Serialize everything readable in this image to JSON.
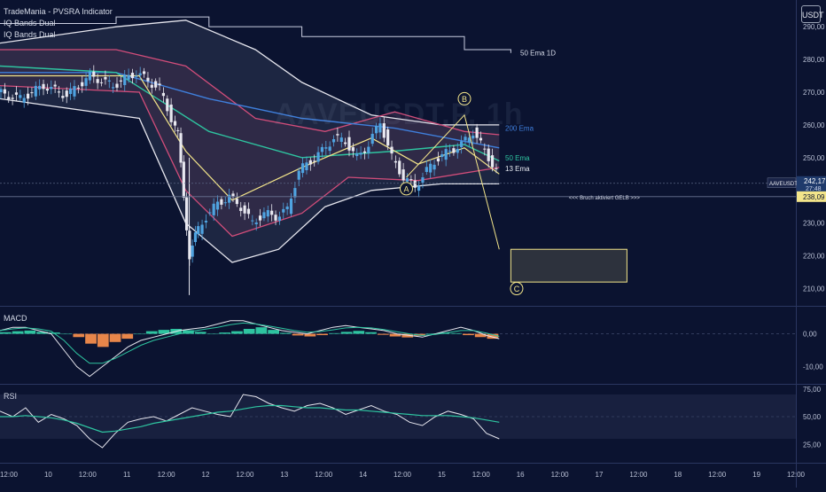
{
  "header": {
    "indicators": [
      "TradeMania - PVSRA Indicator",
      "IQ Bands Dual",
      "IQ Bands Dual"
    ],
    "currency_button": "USDT",
    "watermark": "AAVEUSDT.P, 1h"
  },
  "colors": {
    "background": "#0b1330",
    "bull": "#4fa3e0",
    "bear": "#e8e8f0",
    "ema200": "#3f7fdc",
    "ema50": "#2ec4a0",
    "ema13": "#f3e58a",
    "band_outer": "#e6e6ee",
    "band_inner": "#d24d7a",
    "macd_pos": "#2ec4a0",
    "macd_neg": "#e8864a",
    "rsi_line": "#e6e6ee",
    "rsi_ma": "#2ec4a0",
    "target_box": "#f3e58a"
  },
  "chart_data": [
    {
      "type": "candlestick",
      "symbol": "AAVEUSDT.P",
      "timeframe": "1h",
      "x_ticks": [
        "12:00",
        "10",
        "12:00",
        "11",
        "12:00",
        "12",
        "12:00",
        "13",
        "12:00",
        "14",
        "12:00",
        "15",
        "12:00",
        "16",
        "12:00",
        "17",
        "12:00",
        "18",
        "12:00",
        "19",
        "12:00"
      ],
      "y_ticks": [
        "210,00",
        "220,00",
        "230,00",
        "240,00",
        "250,00",
        "260,00",
        "270,00",
        "280,00",
        "290,00"
      ],
      "ylim": [
        205,
        296
      ],
      "last_price": "242,17",
      "countdown": "27:48",
      "level_price": "238,09",
      "series_labels": {
        "ema_1d": "50 Ema 1D",
        "ema200": "200 Ema",
        "ema50": "50 Ema",
        "ema13": "13 Ema"
      },
      "annotations": {
        "breakout": "<<< Bruch aktiviert GELB >>>",
        "wave_a": "A",
        "wave_b": "B",
        "wave_c": "C"
      },
      "ohlc_path": [
        [
          0,
          270,
          279
        ],
        [
          2,
          268,
          277
        ],
        [
          4,
          272,
          275
        ],
        [
          6,
          269,
          276
        ],
        [
          8,
          275,
          274
        ],
        [
          10,
          272,
          277
        ],
        [
          12,
          276,
          275
        ],
        [
          14,
          271,
          274
        ],
        [
          15,
          262,
          270
        ],
        [
          15.5,
          257,
          262
        ],
        [
          16,
          238,
          258
        ],
        [
          16.5,
          220,
          242
        ],
        [
          17,
          226,
          234
        ],
        [
          18,
          232,
          236
        ],
        [
          19,
          236,
          239
        ],
        [
          20,
          238,
          234
        ],
        [
          21,
          235,
          230
        ],
        [
          22,
          230,
          234
        ],
        [
          23,
          233,
          231
        ],
        [
          24,
          232,
          234
        ],
        [
          25,
          234,
          246
        ],
        [
          26,
          246,
          250
        ],
        [
          27,
          249,
          252
        ],
        [
          28,
          252,
          257
        ],
        [
          29,
          256,
          254
        ],
        [
          30,
          255,
          251
        ],
        [
          31,
          250,
          254
        ],
        [
          32,
          254,
          262
        ],
        [
          33,
          261,
          251
        ],
        [
          34,
          250,
          245
        ],
        [
          35,
          244,
          240
        ],
        [
          36,
          241,
          245
        ],
        [
          37,
          246,
          250
        ],
        [
          38,
          250,
          252
        ],
        [
          39,
          252,
          255
        ],
        [
          40,
          254,
          258
        ],
        [
          41,
          258,
          253
        ],
        [
          42,
          252,
          247
        ],
        [
          43,
          246,
          242
        ]
      ],
      "ema200": [
        [
          0,
          276
        ],
        [
          10,
          276
        ],
        [
          18,
          268
        ],
        [
          26,
          262
        ],
        [
          34,
          259
        ],
        [
          43,
          253
        ]
      ],
      "ema50": [
        [
          0,
          278
        ],
        [
          10,
          276
        ],
        [
          18,
          258
        ],
        [
          26,
          250
        ],
        [
          34,
          252
        ],
        [
          40,
          254
        ],
        [
          43,
          249
        ]
      ],
      "ema13": [
        [
          0,
          275
        ],
        [
          12,
          275
        ],
        [
          16,
          252
        ],
        [
          20,
          237
        ],
        [
          26,
          247
        ],
        [
          32,
          256
        ],
        [
          36,
          248
        ],
        [
          40,
          253
        ],
        [
          43,
          245
        ]
      ],
      "ema_1d": [
        [
          0,
          291
        ],
        [
          8,
          291
        ],
        [
          10,
          293
        ],
        [
          18,
          290
        ],
        [
          26,
          287
        ],
        [
          40,
          283
        ],
        [
          44,
          282
        ]
      ],
      "band_upper": [
        [
          0,
          285
        ],
        [
          10,
          290
        ],
        [
          16,
          292
        ],
        [
          22,
          283
        ],
        [
          26,
          273
        ],
        [
          32,
          263
        ],
        [
          38,
          260
        ],
        [
          43,
          260
        ]
      ],
      "band_lower": [
        [
          0,
          268
        ],
        [
          12,
          262
        ],
        [
          16,
          230
        ],
        [
          20,
          218
        ],
        [
          24,
          222
        ],
        [
          28,
          235
        ],
        [
          32,
          240
        ],
        [
          38,
          242
        ],
        [
          43,
          242
        ]
      ],
      "inner_upper": [
        [
          0,
          283
        ],
        [
          10,
          283
        ],
        [
          16,
          278
        ],
        [
          22,
          262
        ],
        [
          28,
          258
        ],
        [
          34,
          264
        ],
        [
          40,
          258
        ],
        [
          43,
          257
        ]
      ],
      "inner_lower": [
        [
          0,
          272
        ],
        [
          12,
          270
        ],
        [
          16,
          240
        ],
        [
          20,
          226
        ],
        [
          26,
          233
        ],
        [
          30,
          244
        ],
        [
          36,
          243
        ],
        [
          43,
          247
        ]
      ],
      "abc_path": [
        [
          35,
          244
        ],
        [
          40,
          263
        ],
        [
          43,
          222
        ]
      ],
      "target_box": {
        "x0": 44,
        "x1": 54,
        "y0": 212,
        "y1": 222
      }
    },
    {
      "type": "bar",
      "title": "MACD",
      "y_ticks": [
        "0,00",
        "-10,00"
      ],
      "ylim": [
        -15,
        8
      ],
      "histogram": [
        0.5,
        0.8,
        1,
        0.6,
        0.4,
        0,
        -1,
        -3,
        -4,
        -2.5,
        -1.5,
        0,
        0.8,
        1.2,
        1.5,
        1.1,
        0.6,
        0,
        0.4,
        0.8,
        1.5,
        2,
        1.2,
        0.3,
        -0.5,
        -0.8,
        -0.4,
        0.2,
        0.6,
        0.9,
        0.5,
        -0.3,
        -0.8,
        -1.1,
        -0.6,
        0.1,
        0.4,
        0.2,
        -0.4,
        -1,
        -1.5
      ],
      "macd_line": [
        1,
        2,
        2,
        1,
        0,
        -5,
        -10,
        -13,
        -10,
        -7,
        -4,
        -2,
        -1,
        0,
        1,
        1.5,
        2,
        3,
        4,
        4,
        3,
        2,
        1,
        0.5,
        0,
        1,
        2,
        2.5,
        2,
        1.5,
        1,
        0,
        -0.5,
        -1,
        0,
        1,
        2,
        1,
        -0.5,
        -1.5
      ],
      "signal_line": [
        1,
        1.5,
        1.8,
        1.5,
        0.8,
        -2,
        -6,
        -9,
        -9,
        -7.5,
        -5.5,
        -3.5,
        -2,
        -1,
        0,
        0.8,
        1.4,
        2,
        2.8,
        3.3,
        3,
        2.4,
        1.7,
        1,
        0.5,
        0.7,
        1.2,
        1.8,
        2,
        1.8,
        1.3,
        0.6,
        0,
        -0.5,
        -0.2,
        0.4,
        1,
        1,
        0.2,
        -0.8
      ]
    },
    {
      "type": "line",
      "title": "RSI",
      "y_ticks": [
        "25,00",
        "50,00",
        "75,00"
      ],
      "ylim": [
        10,
        78
      ],
      "rsi": [
        55,
        50,
        58,
        45,
        52,
        48,
        42,
        30,
        22,
        35,
        45,
        48,
        50,
        46,
        52,
        58,
        55,
        52,
        50,
        70,
        68,
        62,
        58,
        55,
        60,
        62,
        58,
        52,
        56,
        60,
        55,
        52,
        45,
        42,
        50,
        55,
        52,
        48,
        35,
        30
      ],
      "rsi_ma": [
        50,
        50,
        51,
        50,
        49,
        47,
        44,
        40,
        36,
        37,
        39,
        41,
        44,
        46,
        48,
        50,
        52,
        54,
        55,
        57,
        59,
        60,
        60,
        59,
        58,
        58,
        57,
        56,
        56,
        55,
        54,
        53,
        52,
        51,
        51,
        51,
        50,
        49,
        47,
        45
      ]
    }
  ]
}
